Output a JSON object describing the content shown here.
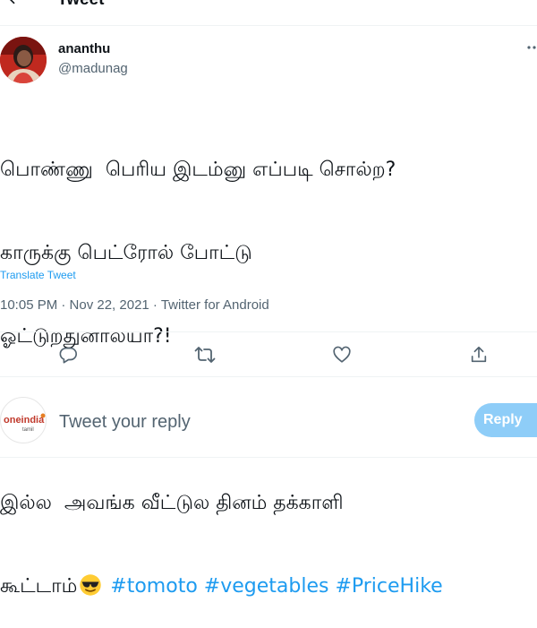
{
  "header": {
    "title": "Tweet"
  },
  "author": {
    "name": "ananthu",
    "handle": "@madunag"
  },
  "tweet": {
    "line1": "பொண்ணு  பெரிய இடம்னு எப்படி சொல்ற?",
    "line2": "காருக்கு பெட்ரோல் போட்டு",
    "line3": "ஓட்டுறதுனாலயா?!",
    "line4": "இல்ல  அவங்க வீட்டுல தினம் தக்காளி",
    "line5_prefix": "கூட்டாம்",
    "emoji": "sunglasses-emoji",
    "hashtags": [
      "#tomoto",
      "#vegetables",
      "#PriceHike"
    ]
  },
  "translate_label": "Translate Tweet",
  "meta": {
    "text": "10:05 PM · Nov 22, 2021 · Twitter for Android"
  },
  "actions": [
    "reply-icon",
    "retweet-icon",
    "like-icon",
    "share-icon"
  ],
  "reply_bar": {
    "logo_text": "oneindia",
    "logo_subtext": "tamil",
    "placeholder": "Tweet your reply",
    "button_label": "Reply"
  },
  "colors": {
    "accent": "#1d9bf0",
    "reply_button": "#8ecdf8",
    "secondary_text": "#536471"
  }
}
